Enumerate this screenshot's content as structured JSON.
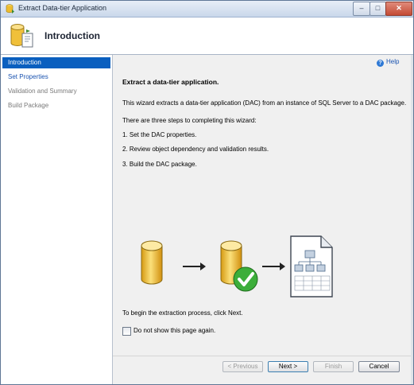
{
  "window": {
    "title": "Extract Data-tier Application",
    "minimize_glyph": "–",
    "maximize_glyph": "□",
    "close_glyph": "✕"
  },
  "header": {
    "title": "Introduction"
  },
  "sidebar": {
    "items": [
      {
        "label": "Introduction",
        "state": "active"
      },
      {
        "label": "Set Properties",
        "state": "link"
      },
      {
        "label": "Validation and Summary",
        "state": "disabled"
      },
      {
        "label": "Build Package",
        "state": "disabled"
      }
    ]
  },
  "main": {
    "help_label": "Help",
    "heading": "Extract a data-tier application.",
    "intro": "This wizard extracts a data-tier application (DAC) from an instance of SQL Server to a DAC package.",
    "steps_intro": "There are three steps to completing this wizard:",
    "steps": [
      "1. Set the DAC properties.",
      "2. Review object dependency and validation results.",
      "3. Build the DAC package."
    ],
    "begin_text": "To begin the extraction process, click Next.",
    "dont_show_label": "Do not show this page again.",
    "dont_show_checked": false
  },
  "footer": {
    "previous": "< Previous",
    "next": "Next >",
    "finish": "Finish",
    "cancel": "Cancel"
  },
  "icons": {
    "app": "database-export-icon",
    "header": "database-package-icon",
    "help": "help-icon"
  },
  "colors": {
    "active_item": "#0a5fbf",
    "link": "#1a53b0",
    "db_yellow": "#f1c232",
    "check_green": "#3cae3a"
  }
}
